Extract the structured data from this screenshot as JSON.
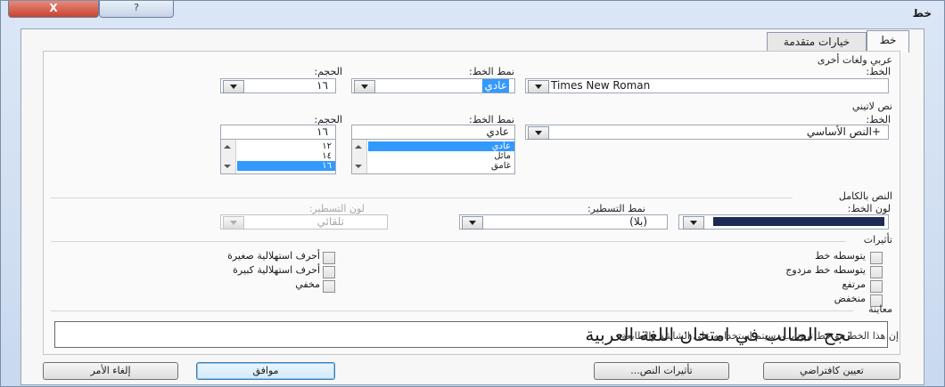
{
  "window": {
    "title": "خط",
    "close_label": "X",
    "help_label": "?"
  },
  "tabs": [
    {
      "label": "خط"
    },
    {
      "label": "خيارات متقدمة"
    }
  ],
  "arabic_section": {
    "heading": "عربي ولغات أخرى",
    "font_label": "الخط:",
    "font_value": "Times New Roman",
    "style_label": "نمط الخط:",
    "style_value": "عادي",
    "size_label": "الحجم:",
    "size_value": "١٦"
  },
  "latin_section": {
    "heading": "نص لاتيني",
    "font_label": "الخط:",
    "font_value": "+النص الأساسي",
    "style_label": "نمط الخط:",
    "style_value": "عادي",
    "style_options": [
      "عادي",
      "مائل",
      "غامق"
    ],
    "style_selected_index": 0,
    "size_label": "الحجم:",
    "size_value": "١٦",
    "size_options": [
      "١٢",
      "١٤",
      "١٦"
    ],
    "size_selected_index": 2
  },
  "complex_section": {
    "heading": "النص بالكامل",
    "font_color_label": "لون الخط:",
    "font_color": "#1c2a55",
    "underline_style_label": "نمط التسطير:",
    "underline_style_value": "(بلا)",
    "underline_color_label": "لون التسطير:",
    "underline_color_value": "تلقائي"
  },
  "effects": {
    "heading": "تأثيرات",
    "right_column": [
      "يتوسطه خط",
      "يتوسطه خط مزدوج",
      "مرتفع",
      "منخفض"
    ],
    "left_column": [
      "أحرف استهلالية صغيرة",
      "أحرف استهلالية كبيرة",
      "مخفي"
    ]
  },
  "preview": {
    "heading": "معاينة",
    "text": "نجح الطالب في امتحان اللغة العربية",
    "note": "إن هذا الخط هو خط تروتايب، سيتم استخدامه على الشاشة والطابعة."
  },
  "buttons": {
    "set_default": "تعيين كافتراضي",
    "text_effects": "تأثيرات النص...",
    "ok": "موافق",
    "cancel": "إلغاء الأمر"
  }
}
